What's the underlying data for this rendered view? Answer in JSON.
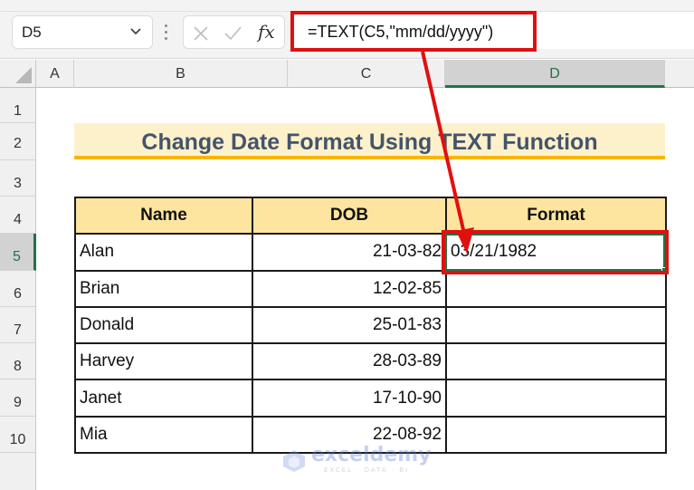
{
  "formula_bar": {
    "name_box": "D5",
    "formula": "=TEXT(C5,\"mm/dd/yyyy\")",
    "cancel_icon": "x-icon",
    "enter_icon": "check-icon",
    "function_label": "fx"
  },
  "grid": {
    "columns": [
      "A",
      "B",
      "C",
      "D"
    ],
    "rows": [
      "1",
      "2",
      "3",
      "4",
      "5",
      "6",
      "7",
      "8",
      "9",
      "10"
    ],
    "selected_column": "D",
    "selected_row": "5"
  },
  "sheet": {
    "title": "Change Date Format Using TEXT Function",
    "headers": [
      "Name",
      "DOB",
      "Format"
    ],
    "rows": [
      {
        "name": "Alan",
        "dob": "21-03-82",
        "format": "03/21/1982"
      },
      {
        "name": "Brian",
        "dob": "12-02-85",
        "format": ""
      },
      {
        "name": "Donald",
        "dob": "25-01-83",
        "format": ""
      },
      {
        "name": "Harvey",
        "dob": "28-03-89",
        "format": ""
      },
      {
        "name": "Janet",
        "dob": "17-10-90",
        "format": ""
      },
      {
        "name": "Mia",
        "dob": "22-08-92",
        "format": ""
      }
    ]
  },
  "colors": {
    "highlight": "#e01010",
    "excel_green": "#217346",
    "title_fill": "#fdf1cc",
    "title_underline": "#f5b800",
    "header_fill": "#fde5a0",
    "title_text": "#44546a"
  },
  "watermark": {
    "name": "exceldemy",
    "tagline": "EXCEL · DATA · BI"
  }
}
